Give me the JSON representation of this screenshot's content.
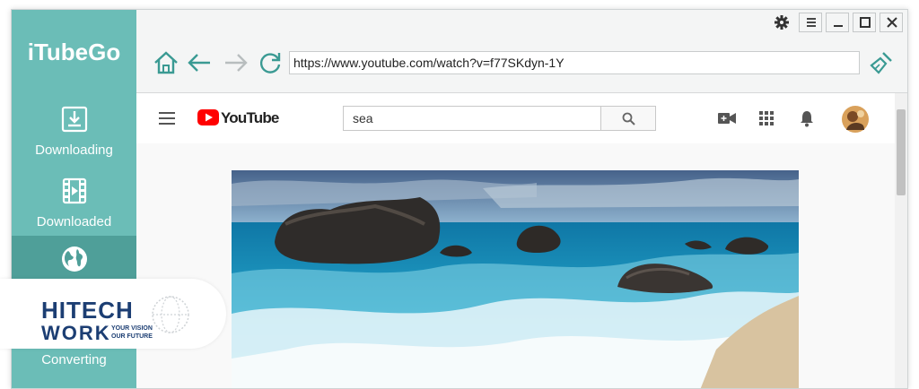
{
  "app": {
    "brand": "iTubeGo",
    "nav": [
      {
        "label": "Downloading",
        "icon": "download-tray-icon"
      },
      {
        "label": "Downloaded",
        "icon": "film-icon"
      },
      {
        "label": "",
        "icon": "globe-icon"
      },
      {
        "label": "Converting",
        "icon": "convert-icon"
      }
    ]
  },
  "toolbar": {
    "url": "https://www.youtube.com/watch?v=f77SKdyn-1Y",
    "icons": [
      "home-icon",
      "back-arrow-icon",
      "forward-arrow-icon",
      "refresh-icon",
      "clean-brush-icon"
    ],
    "window_controls": [
      "settings-gear-icon",
      "menu-icon",
      "minimize-icon",
      "maximize-icon",
      "close-icon"
    ]
  },
  "youtube": {
    "logo_text": "YouTube",
    "search_value": "sea",
    "header_icons": [
      "hamburger-menu-icon",
      "search-icon",
      "video-camera-icon",
      "apps-grid-icon",
      "bell-icon",
      "avatar"
    ]
  },
  "watermark": {
    "brand_top": "HITECH",
    "brand_bottom": "WORK",
    "tagline_1": "YOUR VISION",
    "tagline_2": "OUR FUTURE"
  },
  "colors": {
    "sidebar": "#6bbdb7",
    "sidebar_active": "#4f9f99",
    "accent_teal": "#3a9a93",
    "youtube_red": "#ff0000",
    "watermark_blue": "#1c3e73"
  }
}
